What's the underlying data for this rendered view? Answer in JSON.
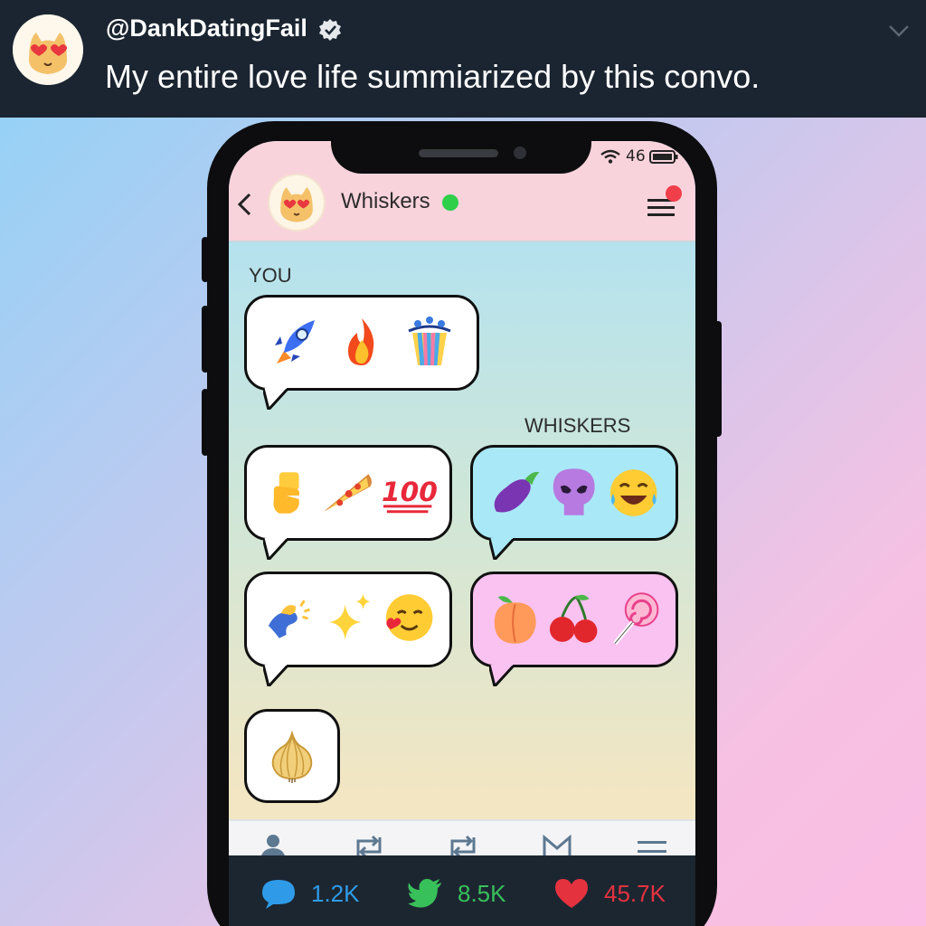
{
  "tweet": {
    "handle": "@DankDatingFail",
    "text": "My entire love life summiarized by this convo."
  },
  "status_bar": {
    "network": "46"
  },
  "chat": {
    "contact_name": "Whiskers",
    "online": true,
    "labels": {
      "you": "YOU",
      "whiskers": "WHISKERS"
    },
    "messages": [
      {
        "sender": "you",
        "emojis": [
          "rocket",
          "fire",
          "popcorn-bucket"
        ]
      },
      {
        "sender": "you",
        "emojis": [
          "thinking-hand",
          "pizza",
          "hundred-points"
        ]
      },
      {
        "sender": "whiskers",
        "emojis": [
          "eggplant",
          "alien-skull",
          "tears-of-joy"
        ]
      },
      {
        "sender": "you",
        "emojis": [
          "fleeing-figure",
          "sparkles",
          "smiling-face-with-heart"
        ]
      },
      {
        "sender": "whiskers",
        "emojis": [
          "peach",
          "cherries",
          "lollipop"
        ]
      },
      {
        "sender": "you",
        "emojis": [
          "onion"
        ]
      }
    ]
  },
  "actions": {
    "replies": "1.2K",
    "retweets": "8.5K",
    "likes": "45.7K"
  },
  "colors": {
    "header_bg": "#1b2531",
    "chat_header_bg": "#f9d3dc",
    "online": "#2fcf4a",
    "reply": "#2f9be8",
    "retweet": "#38c05a",
    "like": "#e5323f"
  }
}
